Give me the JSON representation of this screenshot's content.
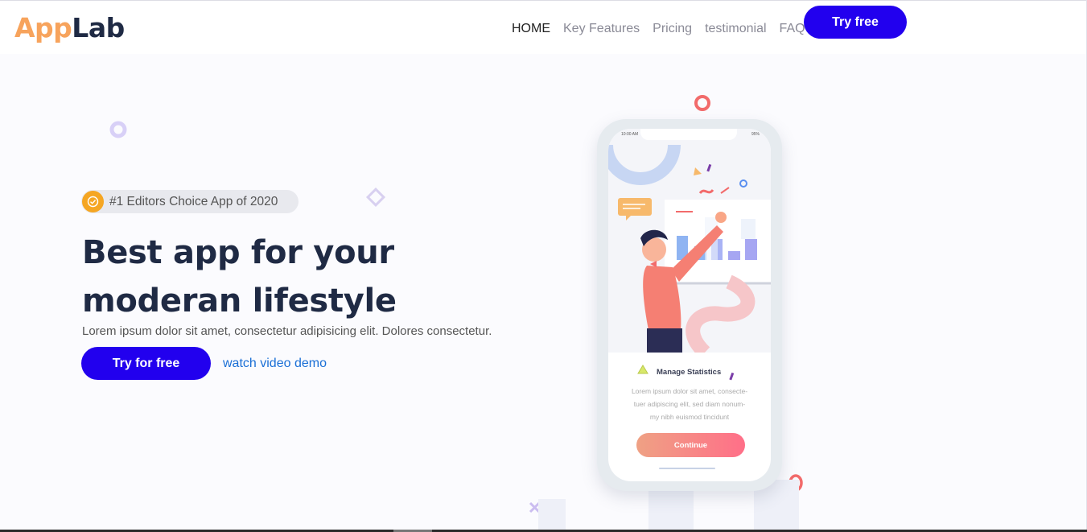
{
  "header": {
    "logo_part1": "App",
    "logo_part2": "Lab",
    "nav": [
      "HOME",
      "Key Features",
      "Pricing",
      "testimonial",
      "FAQ"
    ],
    "cta": "Try free"
  },
  "hero": {
    "badge": "#1 Editors Choice App of 2020",
    "title_line1": "Best app for your",
    "title_line2": "moderan lifestyle",
    "subtitle": "Lorem ipsum dolor sit amet, consectetur adipisicing elit. Dolores consectetur.",
    "primary_button": "Try for free",
    "secondary_link": "watch video demo"
  },
  "phone": {
    "status_time": "10:00 AM",
    "status_battery": "95%",
    "heading": "Manage Statistics",
    "body_line1": "Lorem ipsum dolor sit amet, consecte-",
    "body_line2": "tuer adipiscing elit, sed diam nonum-",
    "body_line3": "my nibh euismod tincidunt",
    "button": "Continue"
  },
  "colors": {
    "accent": "#2200ee",
    "logo_orange": "#f7a35c",
    "heading_navy": "#1f2a44",
    "link_blue": "#1a6fd6",
    "badge_orange": "#f5a623",
    "coral": "#f26b6b"
  },
  "icons": [
    "verified-badge-icon",
    "person-illustration",
    "bar-chart-illustration"
  ]
}
